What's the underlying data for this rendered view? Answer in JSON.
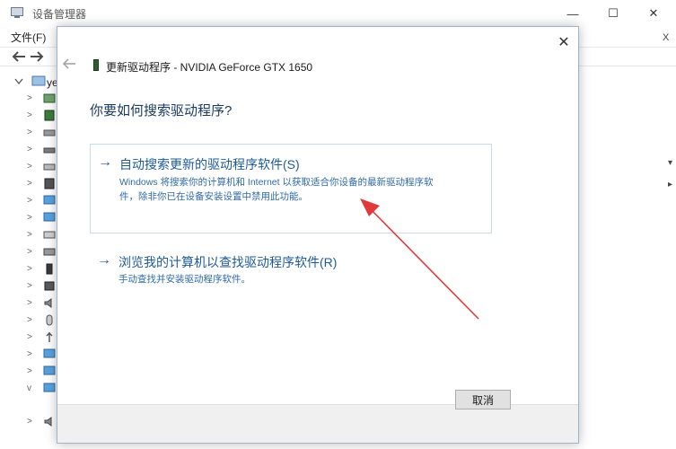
{
  "background_window": {
    "title": "设备管理器",
    "menu_file": "文件(F)",
    "root_label": "ye",
    "right_edge_a": "X",
    "right_edge_b": "▾",
    "right_edge_c": "▸",
    "controls": {
      "minimize": "—",
      "maximize": "☐",
      "close": "✕"
    },
    "icon_names": [
      "device-manager-icon",
      "back-arrow-icon",
      "forward-arrow-icon"
    ]
  },
  "dialog": {
    "close_glyph": "✕",
    "header": "更新驱动程序 - NVIDIA GeForce GTX 1650",
    "question": "你要如何搜索驱动程序?",
    "option_auto": {
      "arrow": "→",
      "title": "自动搜索更新的驱动程序软件(S)",
      "desc_line1": "Windows 将搜索你的计算机和 Internet 以获取适合你设备的最新驱动程序软",
      "desc_line2": "件，除非你已在设备安装设置中禁用此功能。"
    },
    "option_browse": {
      "arrow": "→",
      "title": "浏览我的计算机以查找驱动程序软件(R)",
      "desc": "手动查找并安装驱动程序软件。"
    },
    "cancel_label": "取消"
  },
  "colors": {
    "link_blue": "#1e5a99",
    "desc_blue": "#2f6aa8",
    "heading_blue": "#1a3b62",
    "annotation_red": "#e03b3b"
  }
}
